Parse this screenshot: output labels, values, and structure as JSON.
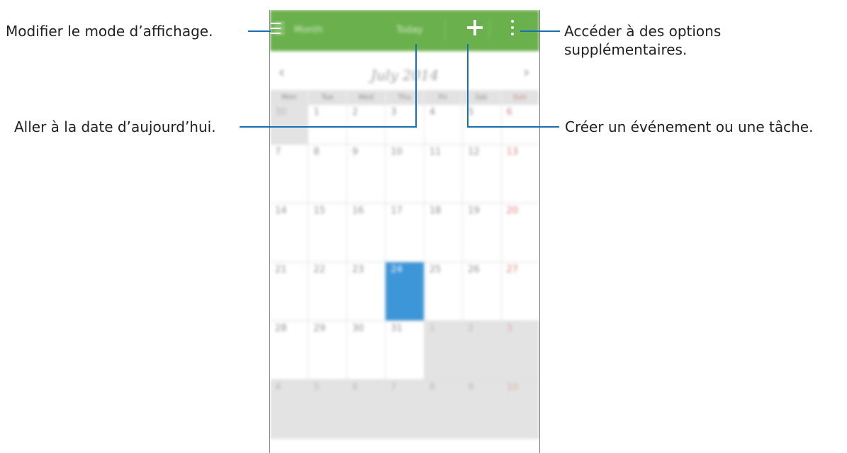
{
  "calendar": {
    "view_label": "Month",
    "today_label": "Today",
    "month_title": "July 2014",
    "prev_arrow": "‹",
    "next_arrow": "›",
    "weekdays": [
      "Mon",
      "Tue",
      "Wed",
      "Thu",
      "Fri",
      "Sat",
      "Sun"
    ],
    "weeks": [
      [
        "30",
        "1",
        "2",
        "3",
        "4",
        "5",
        "6"
      ],
      [
        "7",
        "8",
        "9",
        "10",
        "11",
        "12",
        "13"
      ],
      [
        "14",
        "15",
        "16",
        "17",
        "18",
        "19",
        "20"
      ],
      [
        "21",
        "22",
        "23",
        "24",
        "25",
        "26",
        "27"
      ],
      [
        "28",
        "29",
        "30",
        "31",
        "1",
        "2",
        "3"
      ],
      [
        "4",
        "5",
        "6",
        "7",
        "8",
        "9",
        "10"
      ]
    ],
    "today_date": "24",
    "colors": {
      "actionbar": "#6ab04c",
      "today": "#3d96d8",
      "sunday": "#d77b7b"
    },
    "icons": {
      "view": "menu-icon",
      "add": "plus-icon",
      "more": "more-vert-icon"
    }
  },
  "callouts": {
    "view_mode": "Modifier le mode d’affichage.",
    "more_options_line1": "Accéder à des options",
    "more_options_line2": "supplémentaires.",
    "go_today": "Aller à la date d’aujourd’hui.",
    "create_event": "Créer un événement ou une tâche."
  }
}
